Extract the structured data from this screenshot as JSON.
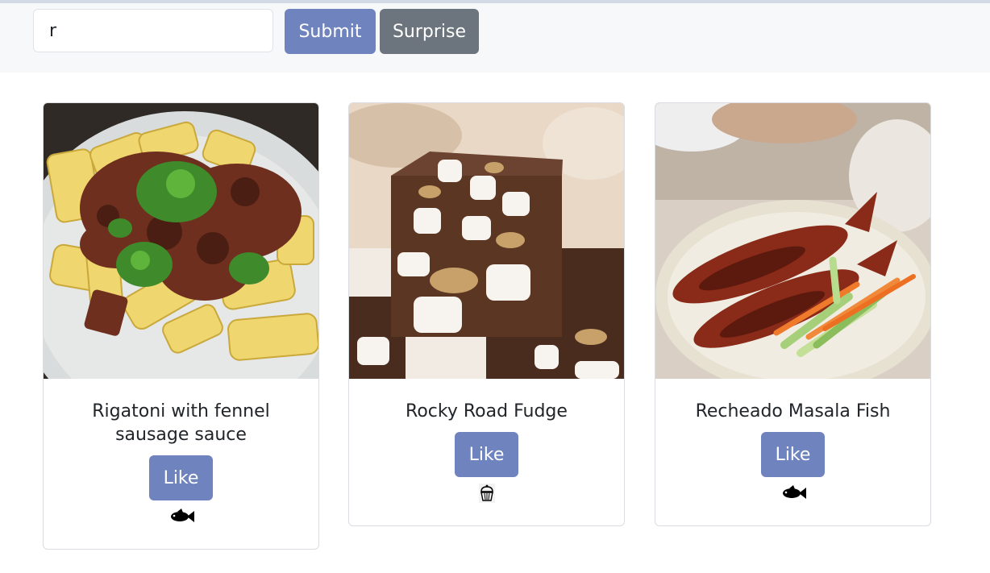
{
  "search": {
    "value": "r"
  },
  "toolbar": {
    "submit_label": "Submit",
    "surprise_label": "Surprise"
  },
  "recipes": [
    {
      "title": "Rigatoni with fennel sausage sauce",
      "like_label": "Like",
      "category_icon": "fish-icon"
    },
    {
      "title": "Rocky Road Fudge",
      "like_label": "Like",
      "category_icon": "cupcake-icon"
    },
    {
      "title": "Recheado Masala Fish",
      "like_label": "Like",
      "category_icon": "fish-icon"
    }
  ],
  "colors": {
    "primary": "#6f84bf",
    "secondary": "#6c757d",
    "header_bg": "#f7f8fa"
  }
}
